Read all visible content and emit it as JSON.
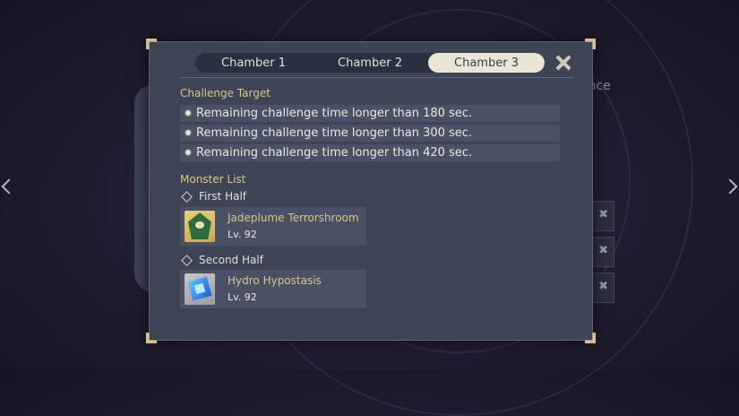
{
  "background": {
    "side_text": "ence",
    "side_buttons": [
      "✖",
      "✖",
      "✖"
    ]
  },
  "tabs": [
    {
      "label": "Chamber 1",
      "active": false
    },
    {
      "label": "Chamber 2",
      "active": false
    },
    {
      "label": "Chamber 3",
      "active": true
    }
  ],
  "challenge": {
    "title": "Challenge Target",
    "targets": [
      "Remaining challenge time longer than 180 sec.",
      "Remaining challenge time longer than 300 sec.",
      "Remaining challenge time longer than 420 sec."
    ]
  },
  "monsters": {
    "title": "Monster List",
    "halves": [
      {
        "label": "First Half",
        "monster": {
          "name": "Jadeplume Terrorshroom",
          "level": "Lv. 92",
          "icon": "jadeplume-terrorshroom-icon"
        }
      },
      {
        "label": "Second Half",
        "monster": {
          "name": "Hydro Hypostasis",
          "level": "Lv. 92",
          "icon": "hydro-hypostasis-icon"
        }
      }
    ]
  },
  "colors": {
    "accent_gold": "#dcc388",
    "panel": "#3d4456",
    "row": "#4a5164"
  }
}
